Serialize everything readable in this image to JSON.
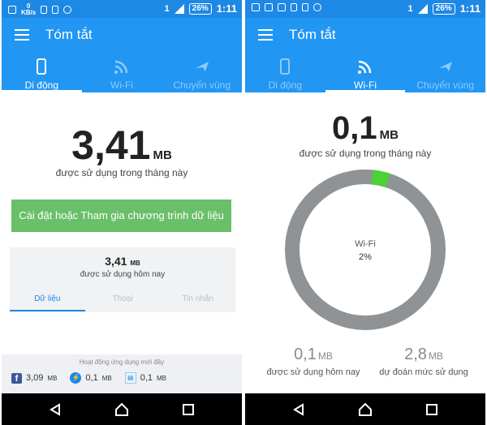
{
  "status_bar": {
    "speed_value": "0",
    "speed_unit": "KB/s",
    "sim": "1",
    "battery": "26%",
    "time": "1:11"
  },
  "app": {
    "title": "Tóm tắt"
  },
  "tabs": [
    {
      "label": "Di động",
      "icon": "phone-icon"
    },
    {
      "label": "Wi-Fi",
      "icon": "wifi-icon"
    },
    {
      "label": "Chuyển vùng",
      "icon": "airplane-icon"
    }
  ],
  "left_screen": {
    "active_tab": "Di động",
    "month_usage": {
      "value": "3,41",
      "unit": "MB",
      "label": "được sử dụng trong tháng này"
    },
    "setup_button": "Cài đặt hoặc Tham gia chương trình dữ liệu",
    "today_card": {
      "value": "3,41",
      "unit": "MB",
      "label": "được sử dụng hôm nay",
      "subtabs": [
        "Dữ liệu",
        "Thoại",
        "Tin nhắn"
      ]
    },
    "recent_activity": {
      "title": "Hoạt động ứng dụng mới đây",
      "items": [
        {
          "icon": "facebook-icon",
          "value": "3,09",
          "unit": "MB"
        },
        {
          "icon": "messenger-icon",
          "value": "0,1",
          "unit": "MB"
        },
        {
          "icon": "app-icon",
          "value": "0,1",
          "unit": "MB"
        }
      ]
    }
  },
  "right_screen": {
    "active_tab": "Wi-Fi",
    "month_usage": {
      "value": "0,1",
      "unit": "MB",
      "label": "được sử dụng trong tháng này"
    },
    "ring": {
      "label": "Wi-Fi",
      "percent_text": "2%",
      "fraction": 0.02,
      "track_color": "#8f9396",
      "fill_color": "#4cd137"
    },
    "today": {
      "value": "0,1",
      "unit": "MB",
      "label": "được sử dụng hôm nay"
    },
    "forecast": {
      "value": "2,8",
      "unit": "MB",
      "label": "dự đoán mức sử dụng"
    }
  },
  "colors": {
    "appbar": "#2196f3",
    "statusbar": "#1e88e5",
    "accent": "#1e88e5",
    "button_green": "#6abf69"
  }
}
